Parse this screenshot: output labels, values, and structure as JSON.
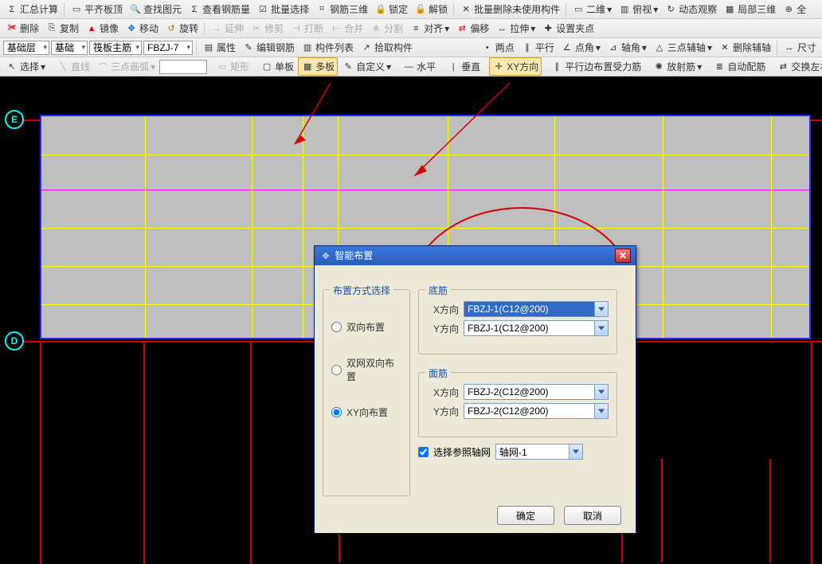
{
  "toolbars": {
    "row1": [
      {
        "label": "汇总计算",
        "icon": "Σ",
        "name": "sum-calc"
      },
      {
        "label": "平齐板顶",
        "icon": "▭",
        "name": "flush-top"
      },
      {
        "label": "查找图元",
        "icon": "🔍",
        "name": "find-element"
      },
      {
        "label": "查看钢筋量",
        "icon": "Σ",
        "name": "view-rebar-qty"
      },
      {
        "label": "批量选择",
        "icon": "☑",
        "name": "batch-select"
      },
      {
        "label": "钢筋三维",
        "icon": "⌗",
        "name": "rebar-3d"
      },
      {
        "label": "锁定",
        "icon": "🔒",
        "name": "lock"
      },
      {
        "label": "解锁",
        "icon": "🔓",
        "name": "unlock"
      },
      {
        "label": "批量删除未使用构件",
        "icon": "✕",
        "name": "batch-delete-unused"
      },
      {
        "label": "二维",
        "icon": "▭",
        "name": "view-2d"
      },
      {
        "label": "俯视",
        "icon": "▥",
        "name": "view-top"
      },
      {
        "label": "动态观察",
        "icon": "↻",
        "name": "dynamic-view"
      },
      {
        "label": "局部三维",
        "icon": "▦",
        "name": "local-3d"
      },
      {
        "label": "全",
        "icon": "⊕",
        "name": "full"
      }
    ],
    "row2": [
      {
        "label": "删除",
        "icon": "✀",
        "name": "delete"
      },
      {
        "label": "复制",
        "icon": "⎘",
        "name": "copy"
      },
      {
        "label": "镜像",
        "icon": "▲",
        "name": "mirror"
      },
      {
        "label": "移动",
        "icon": "✥",
        "name": "move"
      },
      {
        "label": "旋转",
        "icon": "↺",
        "name": "rotate"
      },
      {
        "label": "延伸",
        "icon": "→",
        "name": "extend"
      },
      {
        "label": "修剪",
        "icon": "✂",
        "name": "trim"
      },
      {
        "label": "打断",
        "icon": "⊣",
        "name": "break"
      },
      {
        "label": "合并",
        "icon": "⊢",
        "name": "merge"
      },
      {
        "label": "分割",
        "icon": "⋔",
        "name": "split"
      },
      {
        "label": "对齐",
        "icon": "≡",
        "name": "align"
      },
      {
        "label": "偏移",
        "icon": "⇄",
        "name": "offset"
      },
      {
        "label": "拉伸",
        "icon": "↔",
        "name": "stretch"
      },
      {
        "label": "设置夹点",
        "icon": "✚",
        "name": "set-grip"
      }
    ],
    "row3": {
      "combo1": "基础层",
      "combo2": "基础",
      "combo3": "筏板主筋",
      "combo4": "FBZJ-7",
      "items": [
        {
          "label": "属性",
          "icon": "▤",
          "name": "properties"
        },
        {
          "label": "编辑钢筋",
          "icon": "✎",
          "name": "edit-rebar"
        },
        {
          "label": "构件列表",
          "icon": "▥",
          "name": "component-list"
        },
        {
          "label": "拾取构件",
          "icon": "↗",
          "name": "pick-component"
        }
      ],
      "right": [
        {
          "label": "两点",
          "icon": "•",
          "name": "two-point"
        },
        {
          "label": "平行",
          "icon": "∥",
          "name": "parallel"
        },
        {
          "label": "点角",
          "icon": "∠",
          "name": "point-angle"
        },
        {
          "label": "轴角",
          "icon": "⊿",
          "name": "axis-angle"
        },
        {
          "label": "三点辅轴",
          "icon": "△",
          "name": "three-point-aux"
        },
        {
          "label": "删除辅轴",
          "icon": "✕",
          "name": "delete-aux"
        },
        {
          "label": "尺寸",
          "icon": "↔",
          "name": "dimension"
        }
      ]
    },
    "row4": {
      "left": [
        {
          "label": "选择",
          "icon": "↖",
          "name": "select"
        },
        {
          "label": "直线",
          "icon": "╲",
          "name": "line"
        },
        {
          "label": "三点画弧",
          "icon": "⌒",
          "name": "arc-3pt"
        }
      ],
      "mid": [
        {
          "label": "矩形",
          "icon": "▭",
          "name": "rectangle"
        },
        {
          "label": "单板",
          "icon": "▢",
          "name": "single-slab"
        },
        {
          "label": "多板",
          "icon": "▦",
          "name": "multi-slab",
          "active": true
        },
        {
          "label": "自定义",
          "icon": "✎",
          "name": "custom"
        },
        {
          "label": "水平",
          "icon": "—",
          "name": "horizontal"
        },
        {
          "label": "垂直",
          "icon": "|",
          "name": "vertical"
        },
        {
          "label": "XY方向",
          "icon": "✛",
          "name": "xy-direction",
          "active": true
        },
        {
          "label": "平行边布置受力筋",
          "icon": "∥",
          "name": "parallel-edge-rebar"
        },
        {
          "label": "放射筋",
          "icon": "✺",
          "name": "radial-rebar"
        },
        {
          "label": "自动配筋",
          "icon": "≣",
          "name": "auto-rebar"
        },
        {
          "label": "交换左右标注",
          "icon": "⇄",
          "name": "swap-annotation"
        }
      ]
    }
  },
  "axes": {
    "E": "E",
    "D": "D"
  },
  "dialog": {
    "title": "智能布置",
    "group_layout": "布置方式选择",
    "radio_both": "双向布置",
    "radio_double_net": "双网双向布置",
    "radio_xy": "XY向布置",
    "group_bottom": "底筋",
    "group_top": "面筋",
    "x_label": "X方向",
    "y_label": "Y方向",
    "bottom_x": "FBZJ-1(C12@200)",
    "bottom_y": "FBZJ-1(C12@200)",
    "top_x": "FBZJ-2(C12@200)",
    "top_y": "FBZJ-2(C12@200)",
    "checkbox": "选择参照轴网",
    "axis_combo": "轴网-1",
    "ok": "确定",
    "cancel": "取消"
  }
}
